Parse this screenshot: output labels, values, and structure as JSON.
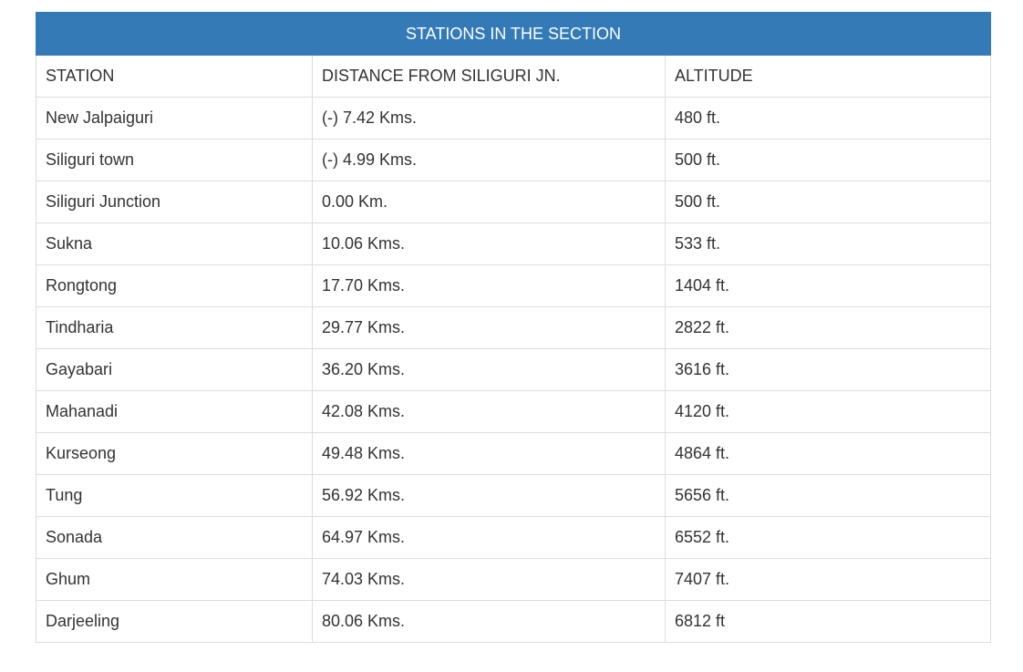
{
  "table": {
    "title": "STATIONS IN THE SECTION",
    "headers": [
      "STATION",
      "DISTANCE FROM SILIGURI JN.",
      "ALTITUDE"
    ],
    "rows": [
      [
        "New Jalpaiguri",
        "(-) 7.42 Kms.",
        "480 ft."
      ],
      [
        "Siliguri town",
        "(-) 4.99 Kms.",
        "500 ft."
      ],
      [
        "Siliguri Junction",
        "0.00 Km.",
        "500 ft."
      ],
      [
        "Sukna",
        "10.06 Kms.",
        "533 ft."
      ],
      [
        "Rongtong",
        "17.70 Kms.",
        "1404 ft."
      ],
      [
        "Tindharia",
        "29.77 Kms.",
        "2822 ft."
      ],
      [
        "Gayabari",
        "36.20 Kms.",
        "3616 ft."
      ],
      [
        "Mahanadi",
        "42.08 Kms.",
        "4120 ft."
      ],
      [
        "Kurseong",
        "49.48 Kms.",
        "4864 ft."
      ],
      [
        "Tung",
        "56.92 Kms.",
        "5656 ft."
      ],
      [
        "Sonada",
        "64.97 Kms.",
        "6552 ft."
      ],
      [
        "Ghum",
        "74.03 Kms.",
        "7407 ft."
      ],
      [
        "Darjeeling",
        "80.06 Kms.",
        "6812 ft"
      ]
    ]
  },
  "colors": {
    "header_bg": "#337ab7",
    "header_text": "#ffffff",
    "border": "#dddddd",
    "text": "#333333"
  }
}
